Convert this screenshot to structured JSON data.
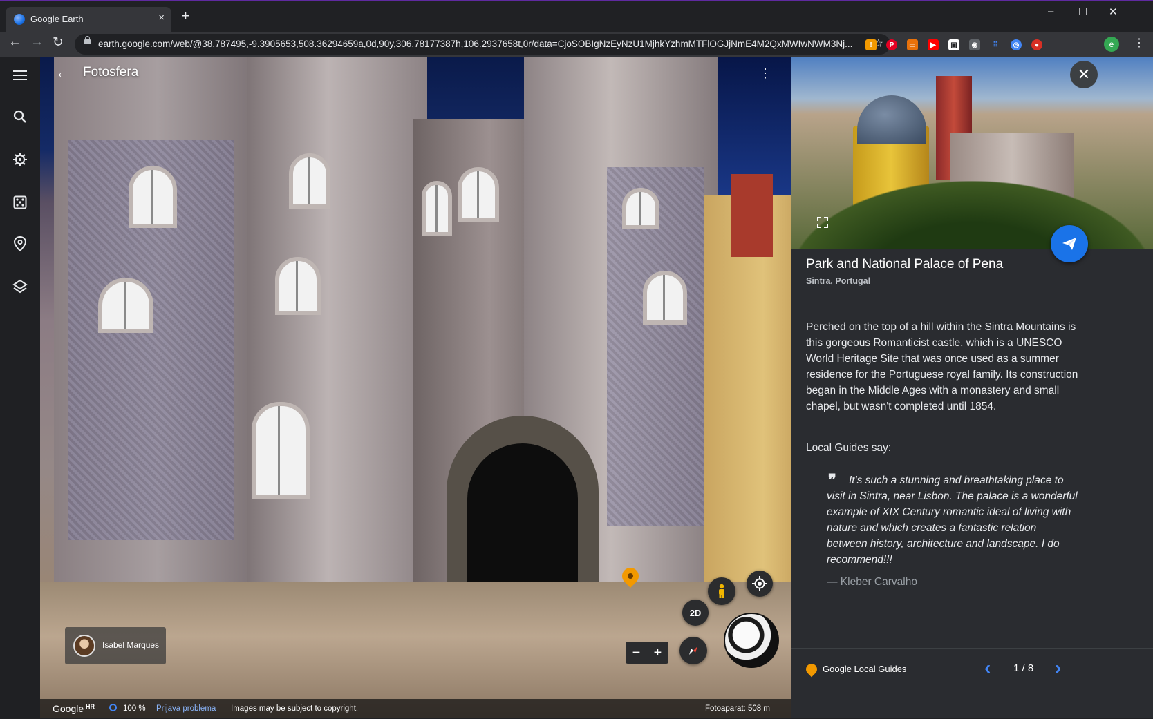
{
  "browser": {
    "tab_title": "Google Earth",
    "tab_close": "×",
    "new_tab": "+",
    "window_minimize": "–",
    "window_maximize": "☐",
    "window_close": "✕",
    "url": "earth.google.com/web/@38.787495,-9.3905653,508.36294659a,0d,90y,306.78177387h,106.2937658t,0r/data=CjoSOBIgNzEyNzU1MjhkYzhmMTFlOGJjNmE4M2QxMWIwNWM3Nj..."
  },
  "viewer": {
    "title": "Fotosfera",
    "author_name": "Isabel Marques",
    "mode_2d": "2D",
    "zoom_out": "−",
    "zoom_in": "+"
  },
  "statusbar": {
    "google": "Google",
    "hr": "HR",
    "percent": "100 %",
    "report_link": "Prijava problema",
    "copyright": "Images may be subject to copyright.",
    "camera": "Fotoaparat: 508 m"
  },
  "panel": {
    "title": "Park and National Palace of Pena",
    "subtitle": "Sintra, Portugal",
    "description": "Perched on the top of a hill within the Sintra Mountains is this gorgeous Romanticist castle, which is a UNESCO World Heritage Site that was once used as a summer residence for the Portuguese royal family. Its construction began in the Middle Ages with a monastery and small chapel, but wasn't completed until 1854.",
    "local_guides_label": "Local Guides say:",
    "quote": "It's such a stunning and breathtaking place to visit in Sintra, near Lisbon. The palace is a wonderful example of XIX Century romantic ideal of living with nature and which creates a fantastic relation between history, architecture and landscape. I do recommend!!!",
    "quote_author": "— Kleber Carvalho",
    "footer_brand": "Google",
    "footer_program": "Local Guides",
    "pager": "1 / 8"
  },
  "icons": {
    "favicon": "earth-icon",
    "rail": [
      "menu-icon",
      "search-icon",
      "voyager-icon",
      "feeling-lucky-icon",
      "projects-icon",
      "map-style-icon"
    ],
    "accent": "#1a73e8",
    "pin_color": "#f29900"
  }
}
